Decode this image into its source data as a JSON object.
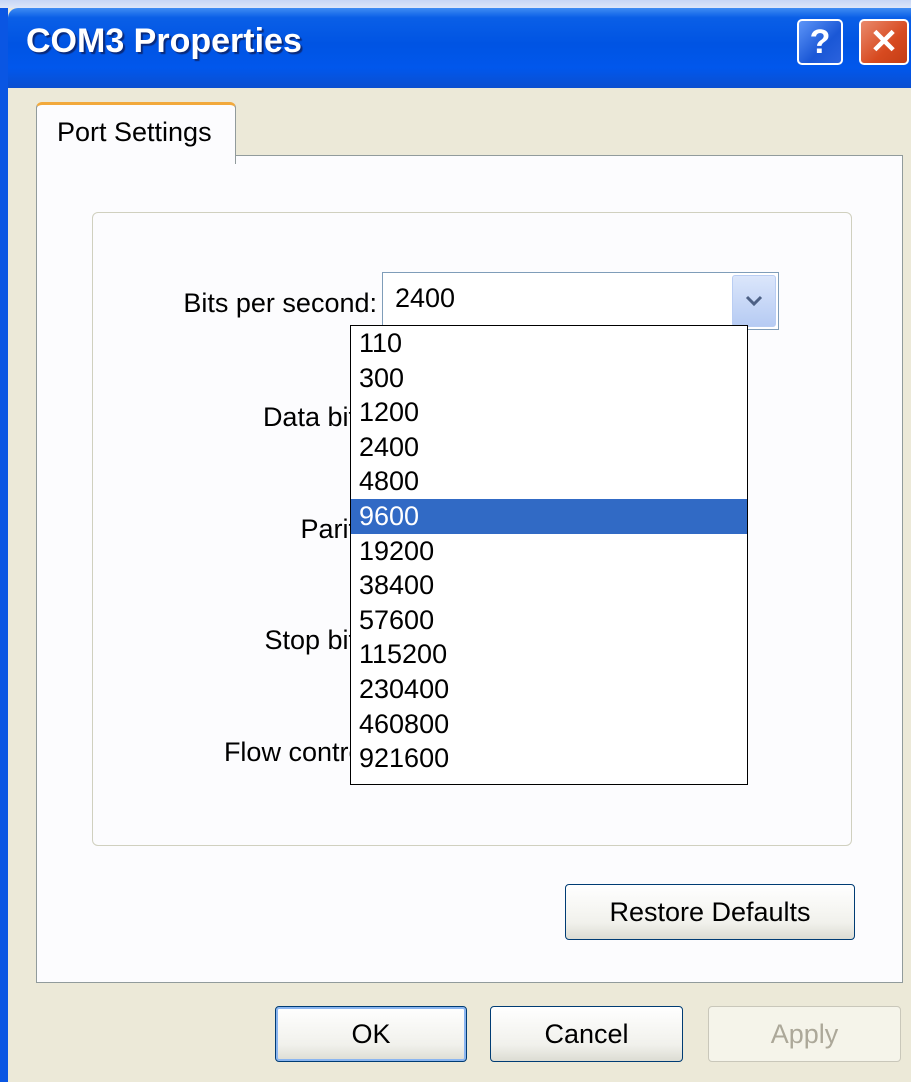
{
  "window": {
    "title": "COM3 Properties",
    "help_glyph": "?",
    "close_glyph": "✕"
  },
  "tabs": [
    {
      "label": "Port Settings"
    }
  ],
  "form": {
    "bits_label": "Bits per second:",
    "bits_value": "2400",
    "data_bits_label": "Data bits:",
    "parity_label": "Parity:",
    "stop_bits_label": "Stop bits:",
    "flow_control_label": "Flow control:"
  },
  "dropdown": {
    "options": [
      "110",
      "300",
      "1200",
      "2400",
      "4800",
      "9600",
      "19200",
      "38400",
      "57600",
      "115200",
      "230400",
      "460800",
      "921600"
    ],
    "highlighted": "9600"
  },
  "buttons": {
    "restore": "Restore Defaults",
    "ok": "OK",
    "cancel": "Cancel",
    "apply": "Apply"
  },
  "colors": {
    "titlebar": "#0054e3",
    "selection": "#316ac5",
    "tab_accent": "#f2a93c"
  },
  "icons": [
    "help-icon",
    "close-icon",
    "chevron-down-icon"
  ]
}
